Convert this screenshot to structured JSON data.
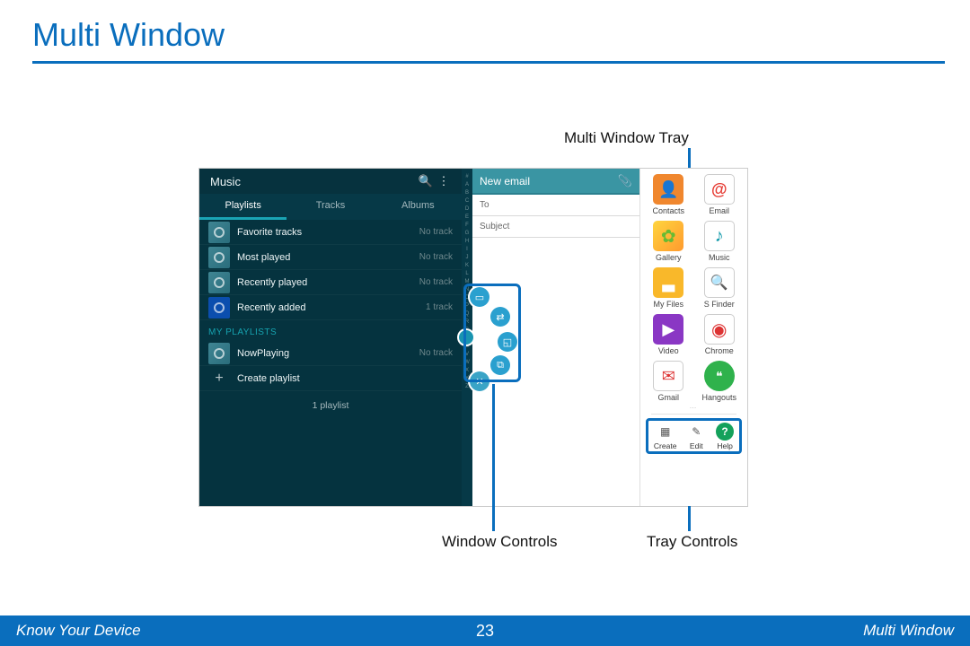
{
  "page": {
    "title": "Multi Window"
  },
  "callouts": {
    "tray_label": "Multi Window Tray",
    "window_controls_label": "Window Controls",
    "tray_controls_label": "Tray Controls"
  },
  "music": {
    "title": "Music",
    "tabs": [
      "Playlists",
      "Tracks",
      "Albums"
    ],
    "active_tab": 0,
    "playlists": [
      {
        "name": "Favorite tracks",
        "count": "No track",
        "thumb": "default"
      },
      {
        "name": "Most played",
        "count": "No track",
        "thumb": "default"
      },
      {
        "name": "Recently played",
        "count": "No track",
        "thumb": "default"
      },
      {
        "name": "Recently added",
        "count": "1 track",
        "thumb": "samsung"
      }
    ],
    "my_playlists_header": "MY PLAYLISTS",
    "user_playlists": [
      {
        "name": "NowPlaying",
        "count": "No track"
      }
    ],
    "create_playlist": "Create playlist",
    "summary": "1 playlist"
  },
  "email": {
    "title": "New email",
    "field_to": "To",
    "field_subject": "Subject"
  },
  "tray": {
    "apps": [
      {
        "label": "Contacts",
        "icon": "contacts"
      },
      {
        "label": "Email",
        "icon": "email"
      },
      {
        "label": "Gallery",
        "icon": "gallery"
      },
      {
        "label": "Music",
        "icon": "music"
      },
      {
        "label": "My Files",
        "icon": "myfiles"
      },
      {
        "label": "S Finder",
        "icon": "sfinder"
      },
      {
        "label": "Video",
        "icon": "video"
      },
      {
        "label": "Chrome",
        "icon": "chrome"
      },
      {
        "label": "Gmail",
        "icon": "gmail"
      },
      {
        "label": "Hangouts",
        "icon": "hangouts"
      }
    ],
    "controls": [
      {
        "label": "Create",
        "icon": "create"
      },
      {
        "label": "Edit",
        "icon": "edit"
      },
      {
        "label": "Help",
        "icon": "help"
      }
    ]
  },
  "footer": {
    "left": "Know Your Device",
    "page": "23",
    "right": "Multi Window"
  }
}
